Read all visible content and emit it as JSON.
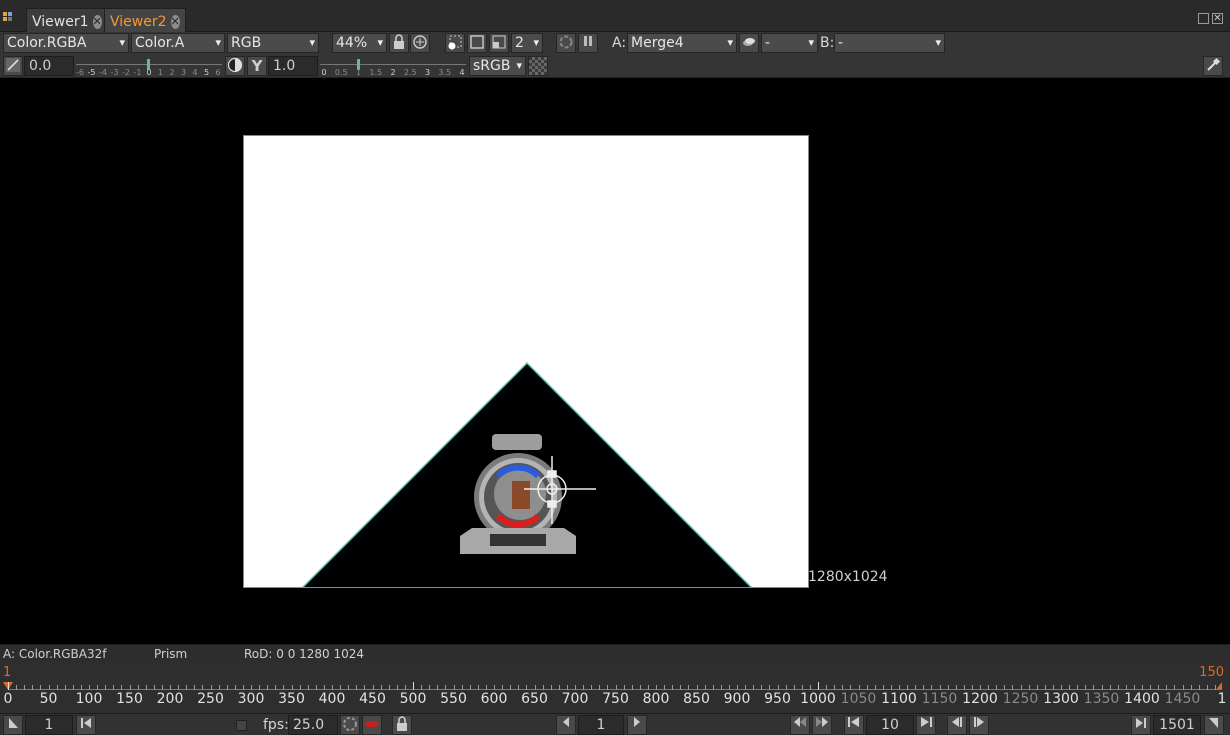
{
  "tabs": [
    {
      "label": "Viewer1",
      "active": false
    },
    {
      "label": "Viewer2",
      "active": true
    }
  ],
  "toolbar": {
    "layer": "Color.RGBA",
    "alpha_channel": "Color.A",
    "display_channels": "RGB",
    "zoom": "44%",
    "proxy_level": "2",
    "input_a_label": "A:",
    "input_a": "Merge4",
    "operation": "-",
    "input_b_label": "B:",
    "input_b": "-",
    "gain": "0.0",
    "gain_ticks": [
      "-6",
      "-5",
      "-4",
      "-3",
      "-2",
      "-1",
      "0",
      "1",
      "2",
      "3",
      "4",
      "5",
      "6"
    ],
    "gamma": "1.0",
    "gamma_ticks": [
      "0",
      "0.5",
      "1",
      "1.5",
      "2",
      "2.5",
      "3",
      "3.5",
      "4"
    ],
    "colorspace": "sRGB"
  },
  "viewer": {
    "resolution": "1280x1024",
    "colors": {
      "background": "#ffffff",
      "shape": "#000000",
      "edge": "#5fc8bf"
    }
  },
  "info": {
    "image_type": "A: Color.RGBA32f",
    "filename": "Prism",
    "rod": "RoD: 0 0 1280 1024"
  },
  "timeline": {
    "start": "1",
    "end": "150",
    "ticks": [
      "0",
      "50",
      "100",
      "150",
      "200",
      "250",
      "300",
      "350",
      "400",
      "450",
      "500",
      "550",
      "600",
      "650",
      "700",
      "750",
      "800",
      "850",
      "900",
      "950",
      "1000",
      "1050",
      "1100",
      "1150",
      "1200",
      "1250",
      "1300",
      "1350",
      "1400",
      "1450",
      "1"
    ],
    "accent": "#e06a1b"
  },
  "playback": {
    "first_frame": "1",
    "fps_label": "fps:",
    "fps": "25.0",
    "current_frame": "1",
    "increment": "10",
    "last_frame": "1501"
  }
}
